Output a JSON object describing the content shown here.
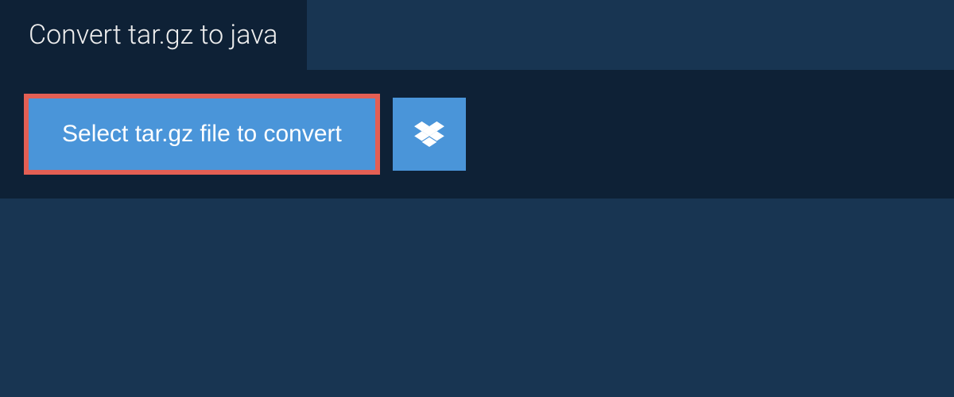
{
  "tab": {
    "title": "Convert tar.gz to java"
  },
  "actions": {
    "select_label": "Select tar.gz file to convert"
  },
  "colors": {
    "background": "#183552",
    "panel": "#0e2136",
    "button": "#4a95d9",
    "highlight_border": "#e35f54",
    "text": "#ffffff"
  }
}
